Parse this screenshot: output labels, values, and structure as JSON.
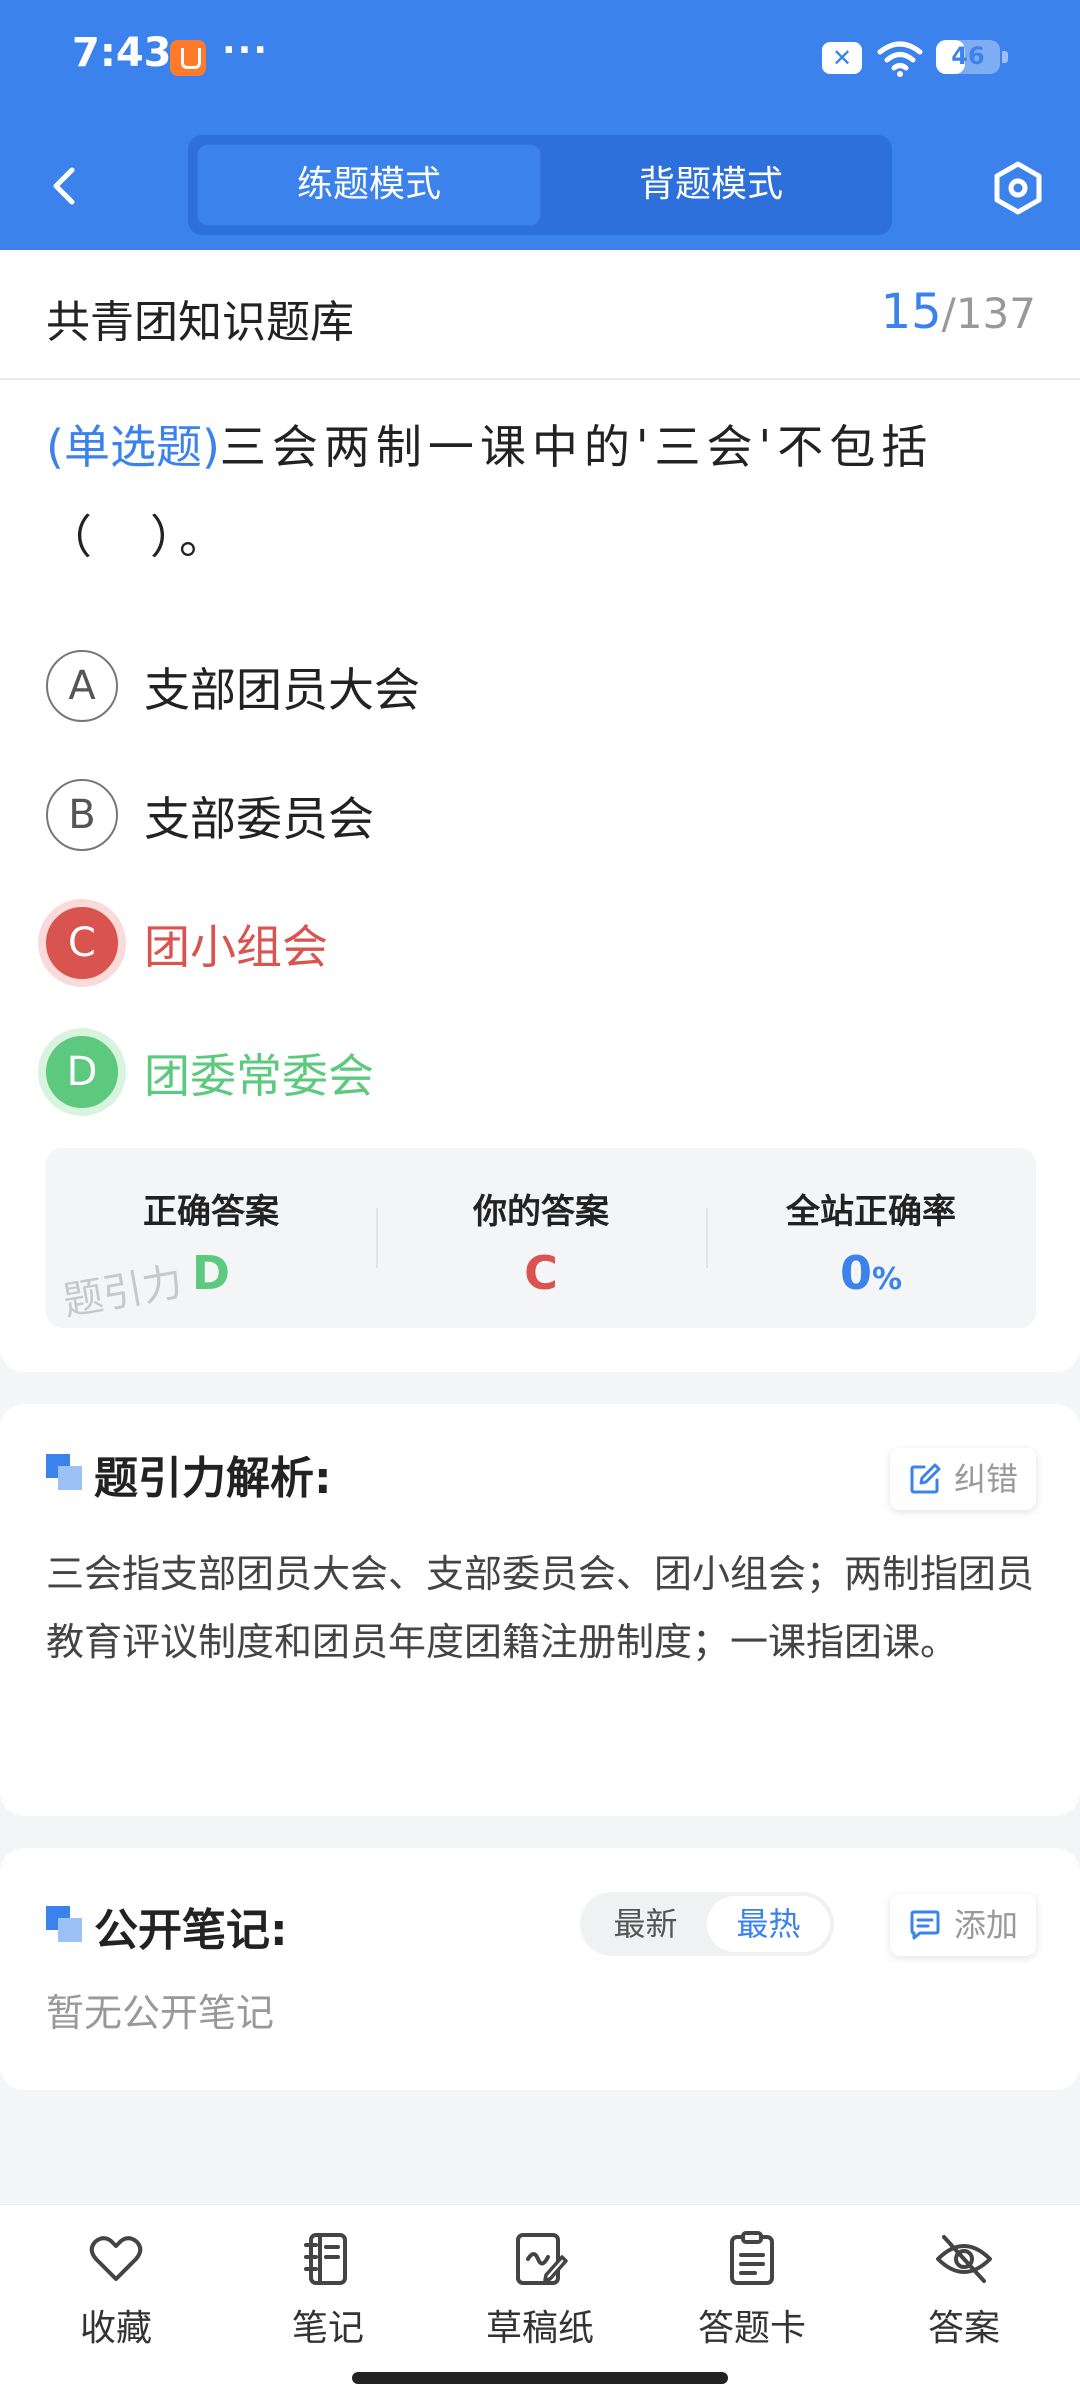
{
  "status": {
    "time": "7:43",
    "dots": "···",
    "battery_level": "46",
    "battery_fraction": 0.46
  },
  "header": {
    "modes": [
      "练题模式",
      "背题模式"
    ],
    "active_mode": 0
  },
  "bank": {
    "title": "共青团知识题库",
    "current": "15",
    "separator": "/",
    "total": "137"
  },
  "question": {
    "type": "(单选题)",
    "text": "三会两制一课中的'三会'不包括（　）。",
    "options": [
      {
        "letter": "A",
        "text": "支部团员大会",
        "state": "normal"
      },
      {
        "letter": "B",
        "text": "支部委员会",
        "state": "normal"
      },
      {
        "letter": "C",
        "text": "团小组会",
        "state": "wrong"
      },
      {
        "letter": "D",
        "text": "团委常委会",
        "state": "correct"
      }
    ]
  },
  "stats": {
    "correct_label": "正确答案",
    "correct_value": "D",
    "yours_label": "你的答案",
    "yours_value": "C",
    "rate_label": "全站正确率",
    "rate_value": "0",
    "rate_unit": "%",
    "watermark": "题引力"
  },
  "analysis": {
    "title": "题引力解析:",
    "report_label": "纠错",
    "text": "三会指支部团员大会、支部委员会、团小组会；两制指团员教育评议制度和团员年度团籍注册制度；一课指团课。"
  },
  "notes": {
    "title": "公开笔记:",
    "sort_options": [
      "最新",
      "最热"
    ],
    "active_sort": 1,
    "add_label": "添加",
    "empty_text": "暂无公开笔记"
  },
  "bottom_bar": [
    {
      "label": "收藏",
      "icon": "heart-icon"
    },
    {
      "label": "笔记",
      "icon": "notebook-icon"
    },
    {
      "label": "草稿纸",
      "icon": "draft-icon"
    },
    {
      "label": "答题卡",
      "icon": "clipboard-icon"
    },
    {
      "label": "答案",
      "icon": "eye-off-icon"
    }
  ],
  "colors": {
    "primary": "#3b82ec",
    "wrong": "#d9534f",
    "correct": "#5cc97e"
  }
}
